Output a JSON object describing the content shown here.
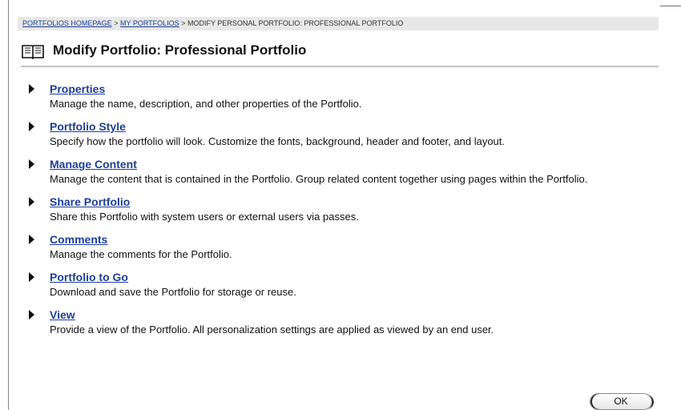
{
  "breadcrumb": {
    "items": [
      {
        "label": "PORTFOLIOS HOMEPAGE",
        "link": true
      },
      {
        "label": "MY PORTFOLIOS",
        "link": true
      },
      {
        "label": "MODIFY PERSONAL PORTFOLIO: PROFESSIONAL PORTFOLIO",
        "link": false
      }
    ],
    "separator": ">"
  },
  "page": {
    "title": "Modify Portfolio: Professional Portfolio",
    "title_icon": "book-icon"
  },
  "menu": {
    "items": [
      {
        "label": "Properties",
        "description": "Manage the name, description, and other properties of the Portfolio."
      },
      {
        "label": "Portfolio Style",
        "description": "Specify how the portfolio will look. Customize the fonts, background, header and footer, and layout."
      },
      {
        "label": "Manage Content",
        "description": "Manage the content that is contained in the Portfolio. Group related content together using pages within the Portfolio."
      },
      {
        "label": "Share Portfolio",
        "description": "Share this Portfolio with system users or external users via passes."
      },
      {
        "label": "Comments",
        "description": "Manage the comments for the Portfolio."
      },
      {
        "label": "Portfolio to Go",
        "description": "Download and save the Portfolio for storage or reuse."
      },
      {
        "label": "View",
        "description": "Provide a view of the Portfolio. All personalization settings are applied as viewed by an end user."
      }
    ],
    "bullet_icon": "triangle-right-icon"
  },
  "footer": {
    "ok_label": "OK"
  },
  "colors": {
    "link": "#1d3f99",
    "breadcrumb_bg": "#e8e8e8",
    "rule": "#c4c4c4",
    "text": "#111111"
  }
}
